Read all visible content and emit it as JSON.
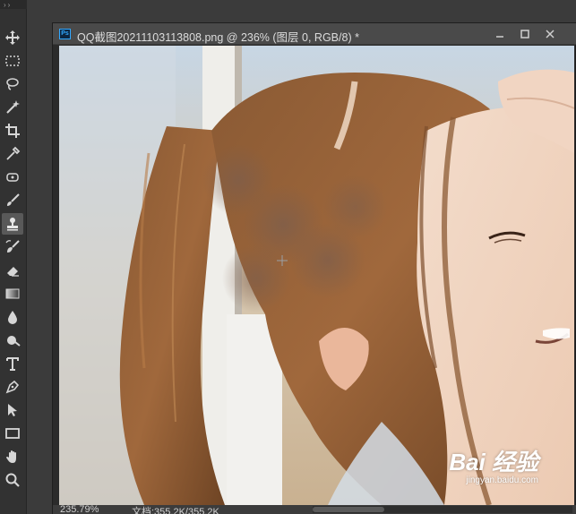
{
  "document": {
    "badge": "Ps",
    "title": "QQ截图20211103113808.png @ 236% (图层 0, RGB/8) *"
  },
  "status": {
    "zoom": "235.79%",
    "doc_info": "文档:355.2K/355.2K"
  },
  "watermark": {
    "logo": "Bai 经验",
    "url": "jingyan.baidu.com"
  },
  "tools": [
    {
      "name": "move-tool-icon",
      "active": false
    },
    {
      "name": "marquee-tool-icon",
      "active": false
    },
    {
      "name": "lasso-tool-icon",
      "active": false
    },
    {
      "name": "magic-wand-tool-icon",
      "active": false
    },
    {
      "name": "crop-tool-icon",
      "active": false
    },
    {
      "name": "eyedropper-tool-icon",
      "active": false
    },
    {
      "name": "healing-brush-tool-icon",
      "active": false
    },
    {
      "name": "brush-tool-icon",
      "active": false
    },
    {
      "name": "clone-stamp-tool-icon",
      "active": true
    },
    {
      "name": "history-brush-tool-icon",
      "active": false
    },
    {
      "name": "eraser-tool-icon",
      "active": false
    },
    {
      "name": "gradient-tool-icon",
      "active": false
    },
    {
      "name": "blur-tool-icon",
      "active": false
    },
    {
      "name": "dodge-tool-icon",
      "active": false
    },
    {
      "name": "type-tool-icon",
      "active": false
    },
    {
      "name": "pen-tool-icon",
      "active": false
    },
    {
      "name": "path-selection-tool-icon",
      "active": false
    },
    {
      "name": "rectangle-tool-icon",
      "active": false
    },
    {
      "name": "hand-tool-icon",
      "active": false
    },
    {
      "name": "zoom-tool-icon",
      "active": false
    }
  ],
  "colors": {
    "panel_bg": "#323232",
    "title_bg": "#4a4a4a",
    "ps_blue": "#31a8ff",
    "icon": "#d6d6d6"
  }
}
